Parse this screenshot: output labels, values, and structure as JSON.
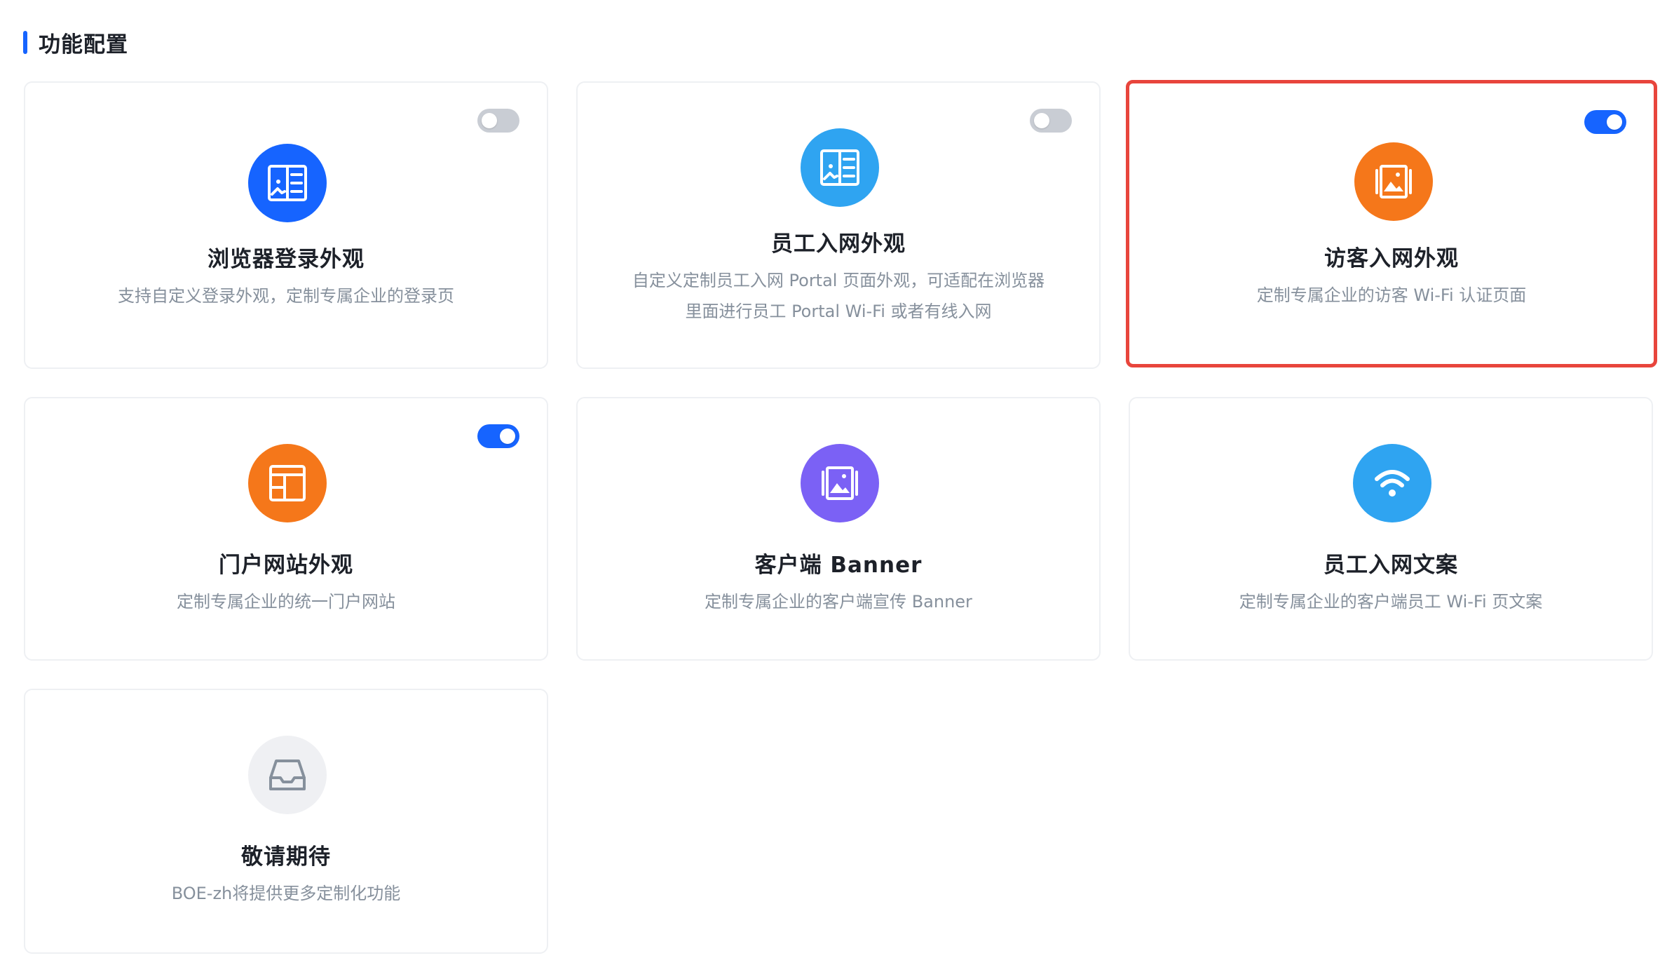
{
  "section": {
    "title": "功能配置"
  },
  "colors": {
    "accent": "#1664ff",
    "highlight_border": "#e8453c",
    "icon_blue": "#1664ff",
    "icon_sky": "#2fa4f1",
    "icon_orange": "#f5771a",
    "icon_purple": "#7b61f5",
    "icon_gray": "#eff0f3"
  },
  "cards": [
    {
      "title": "浏览器登录外观",
      "desc": [
        "支持自定义登录外观，定制专属企业的登录页"
      ],
      "toggle": "off",
      "icon": "book-icon"
    },
    {
      "title": "员工入网外观",
      "desc": [
        "自定义定制员工入网 Portal 页面外观，可适配在浏览器",
        "里面进行员工 Portal Wi-Fi 或者有线入网"
      ],
      "toggle": "off",
      "icon": "book-icon"
    },
    {
      "title": "访客入网外观",
      "desc": [
        "定制专属企业的访客 Wi-Fi 认证页面"
      ],
      "toggle": "on",
      "icon": "image-gallery-icon"
    },
    {
      "title": "门户网站外观",
      "desc": [
        "定制专属企业的统一门户网站"
      ],
      "toggle": "on",
      "icon": "layout-icon"
    },
    {
      "title": "客户端 Banner",
      "desc": [
        "定制专属企业的客户端宣传 Banner"
      ],
      "icon": "image-gallery-icon"
    },
    {
      "title": "员工入网文案",
      "desc": [
        "定制专属企业的客户端员工 Wi-Fi 页文案"
      ],
      "icon": "wifi-icon"
    },
    {
      "title": "敬请期待",
      "desc": [
        "BOE-zh将提供更多定制化功能"
      ],
      "icon": "inbox-icon"
    }
  ]
}
